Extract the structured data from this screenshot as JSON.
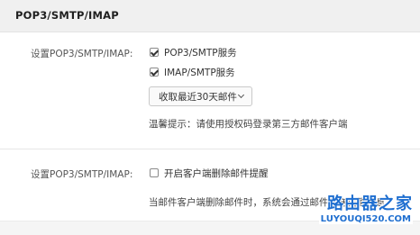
{
  "header": {
    "title": "POP3/SMTP/IMAP"
  },
  "section1": {
    "label": "设置POP3/SMTP/IMAP:",
    "options": [
      {
        "label": "POP3/SMTP服务",
        "checked": true
      },
      {
        "label": "IMAP/SMTP服务",
        "checked": true
      }
    ],
    "select": {
      "value": "收取最近30天邮件"
    },
    "hint": "温馨提示：请使用授权码登录第三方邮件客户端"
  },
  "section2": {
    "label": "设置POP3/SMTP/IMAP:",
    "option": {
      "label": "开启客户端删除邮件提醒",
      "checked": false
    },
    "hint": "当邮件客户端删除邮件时，系统会通过邮件发送提醒信息"
  },
  "watermark": {
    "top": "路由器之家",
    "bottom": "LUYOUQI520.COM"
  }
}
